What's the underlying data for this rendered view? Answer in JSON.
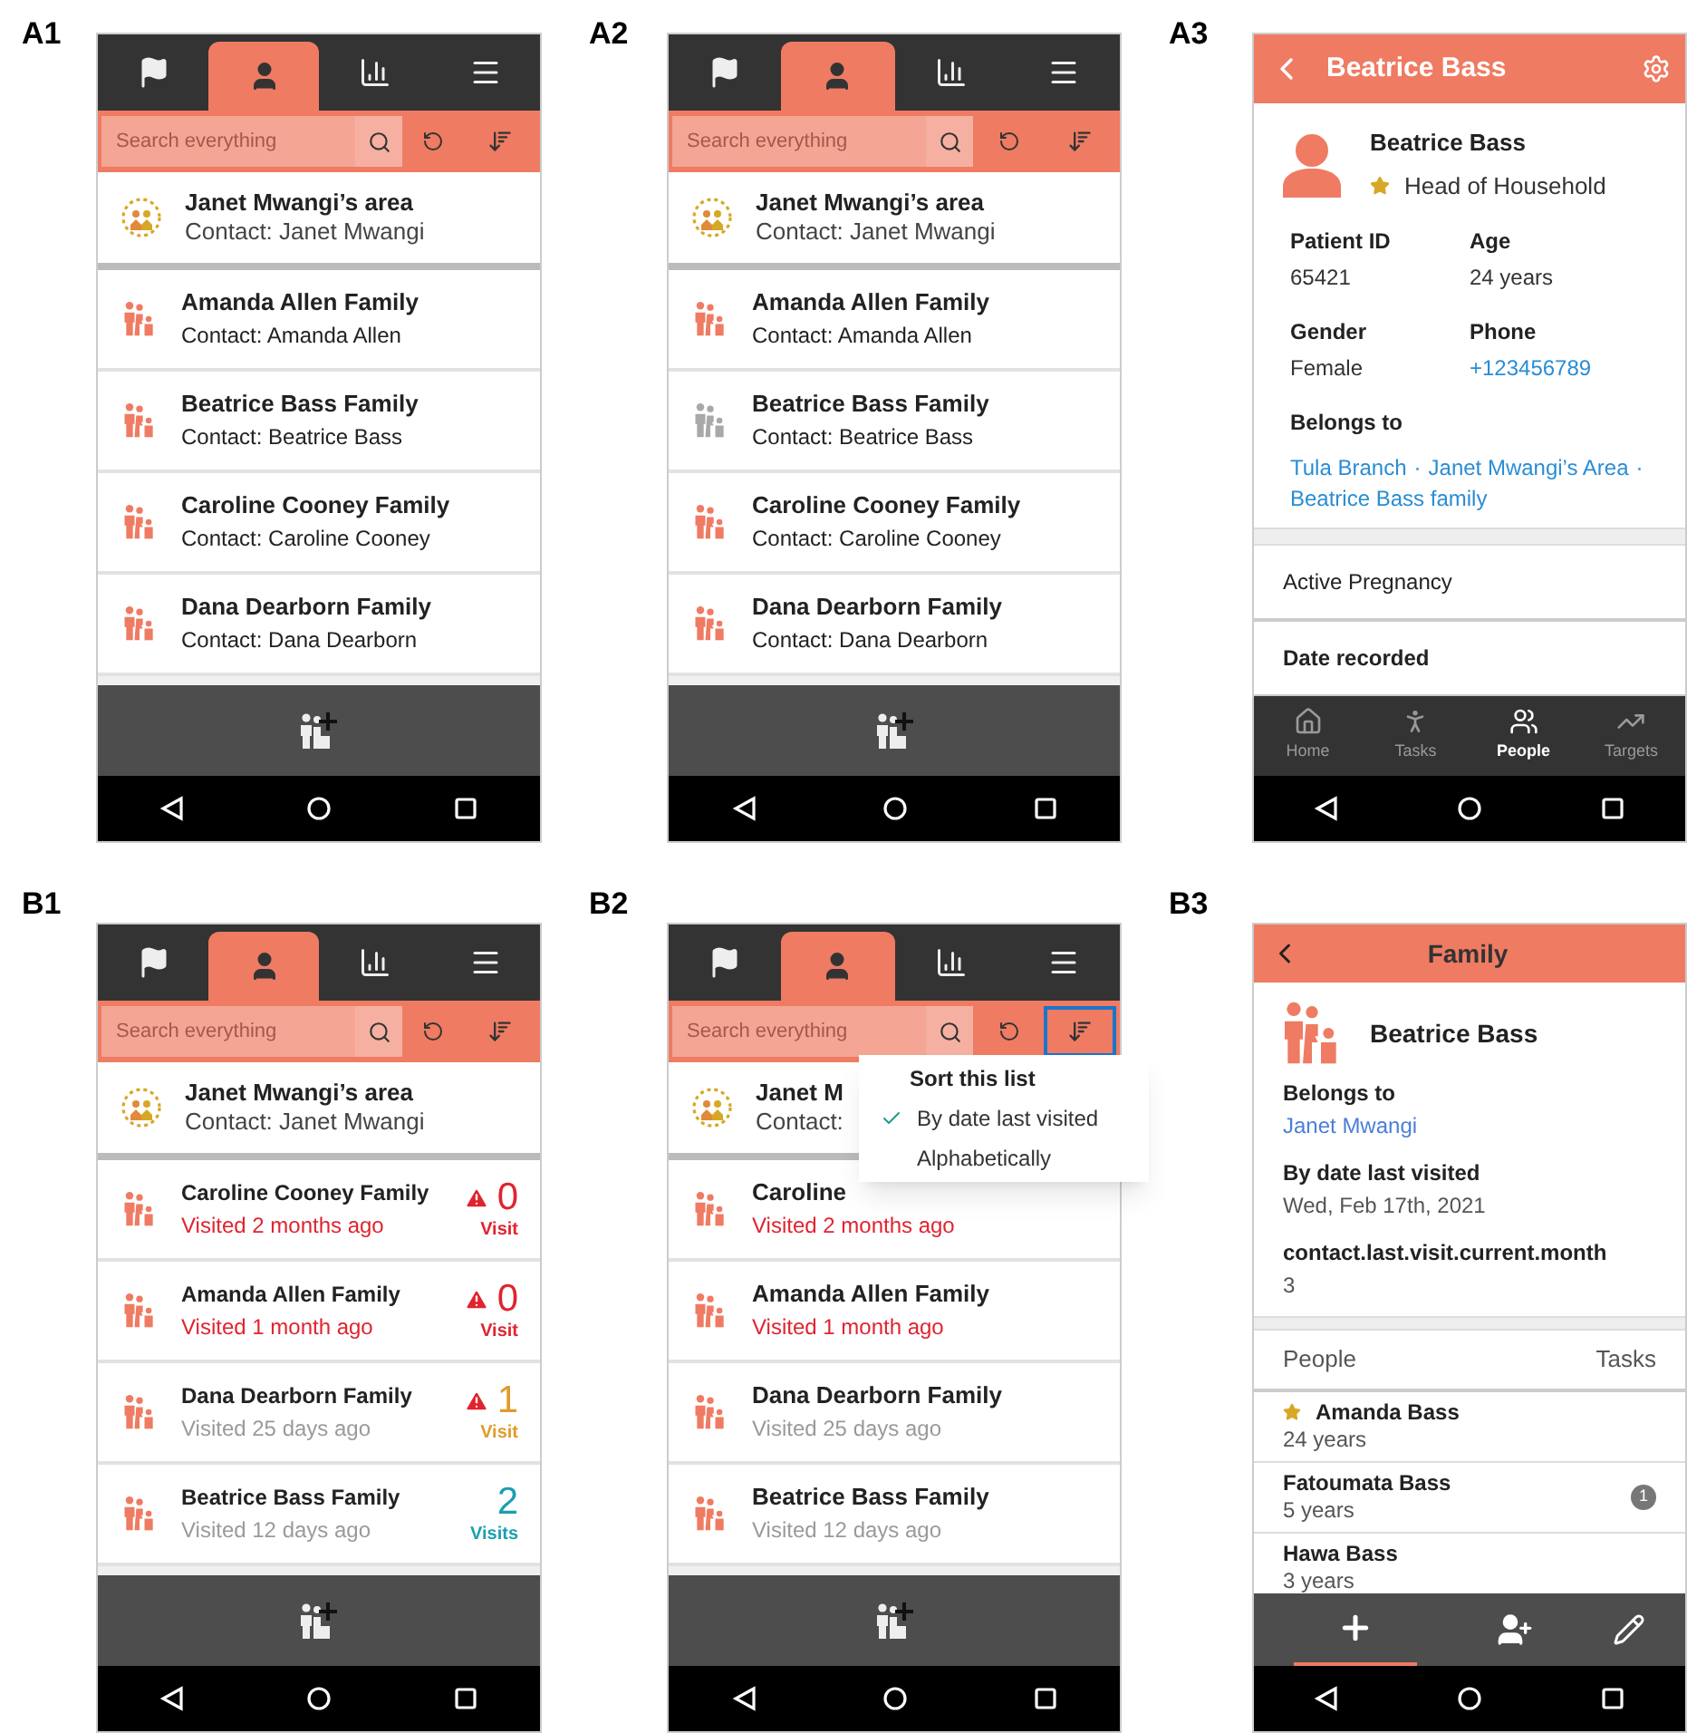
{
  "panels": [
    {
      "label": "A1",
      "kind": "list",
      "tabs": [
        {
          "selected": false
        },
        {
          "selected": true
        },
        {
          "selected": false
        },
        {
          "selected": false
        }
      ],
      "search": {
        "placeholder": "Search everything"
      },
      "sort_highlighted": false,
      "area": {
        "title": "Janet Mwangi’s area",
        "subtitle": "Contact: Janet Mwangi"
      },
      "rows": [
        {
          "title": "Amanda Allen Family",
          "subtitle": "Contact: Amanda Allen",
          "icon_greyed": false
        },
        {
          "title": "Beatrice Bass Family",
          "subtitle": "Contact: Beatrice Bass",
          "icon_greyed": false
        },
        {
          "title": "Caroline Cooney Family",
          "subtitle": "Contact: Caroline Cooney",
          "icon_greyed": false
        },
        {
          "title": "Dana Dearborn Family",
          "subtitle": "Contact: Dana Dearborn",
          "icon_greyed": false
        }
      ]
    },
    {
      "label": "A2",
      "kind": "list",
      "tabs": [
        {
          "selected": false
        },
        {
          "selected": true
        },
        {
          "selected": false
        },
        {
          "selected": false
        }
      ],
      "search": {
        "placeholder": "Search everything"
      },
      "sort_highlighted": false,
      "area": {
        "title": "Janet Mwangi’s area",
        "subtitle": "Contact: Janet Mwangi"
      },
      "rows": [
        {
          "title": "Amanda Allen Family",
          "subtitle": "Contact: Amanda Allen",
          "icon_greyed": false
        },
        {
          "title": "Beatrice Bass Family",
          "subtitle": "Contact: Beatrice Bass",
          "icon_greyed": true
        },
        {
          "title": "Caroline Cooney Family",
          "subtitle": "Contact: Caroline Cooney",
          "icon_greyed": false
        },
        {
          "title": "Dana Dearborn Family",
          "subtitle": "Contact: Dana Dearborn",
          "icon_greyed": false
        }
      ]
    },
    {
      "label": "A3",
      "kind": "detail",
      "header": {
        "title": "Beatrice Bass"
      },
      "profile": {
        "name": "Beatrice Bass",
        "role": "Head of Household"
      },
      "fields": [
        {
          "label": "Patient ID",
          "value": "65421",
          "link": false
        },
        {
          "label": "Age",
          "value": "24 years",
          "link": false
        },
        {
          "label": "Gender",
          "value": "Female",
          "link": false
        },
        {
          "label": "Phone",
          "value": "+123456789",
          "link": true
        }
      ],
      "belongs_to": {
        "label": "Belongs to",
        "separator": "·",
        "links": [
          "Tula Branch",
          "Janet Mwangi’s Area",
          "Beatrice Bass family"
        ]
      },
      "sections": [
        "Active Pregnancy",
        "Date recorded"
      ],
      "bottom_nav": [
        {
          "label": "Home",
          "selected": false
        },
        {
          "label": "Tasks",
          "selected": false
        },
        {
          "label": "People",
          "selected": true
        },
        {
          "label": "Targets",
          "selected": false
        }
      ]
    },
    {
      "label": "B1",
      "kind": "list",
      "tabs": [
        {
          "selected": false
        },
        {
          "selected": true
        },
        {
          "selected": false
        },
        {
          "selected": false
        }
      ],
      "search": {
        "placeholder": "Search everything"
      },
      "sort_highlighted": false,
      "area": {
        "title": "Janet Mwangi’s area",
        "subtitle": "Contact: Janet Mwangi"
      },
      "rows": [
        {
          "title": "Caroline Cooney Family",
          "subtitle": "Visited 2 months ago",
          "icon_greyed": false,
          "overdue": true,
          "count": {
            "value": "0",
            "label": "Visit",
            "warning": true,
            "color": "#e0242f"
          }
        },
        {
          "title": "Amanda Allen Family",
          "subtitle": "Visited 1 month ago",
          "icon_greyed": false,
          "overdue": true,
          "count": {
            "value": "0",
            "label": "Visit",
            "warning": true,
            "color": "#e0242f"
          }
        },
        {
          "title": "Dana Dearborn Family",
          "subtitle": "Visited 25 days ago",
          "icon_greyed": false,
          "overdue": false,
          "count": {
            "value": "1",
            "label": "Visit",
            "warning": true,
            "color": "#e09b2d"
          }
        },
        {
          "title": "Beatrice Bass Family",
          "subtitle": "Visited 12 days ago",
          "icon_greyed": false,
          "overdue": false,
          "count": {
            "value": "2",
            "label": "Visits",
            "warning": false,
            "color": "#1a9fb0"
          }
        }
      ]
    },
    {
      "label": "B2",
      "kind": "list",
      "tabs": [
        {
          "selected": false
        },
        {
          "selected": true
        },
        {
          "selected": false
        },
        {
          "selected": false
        }
      ],
      "search": {
        "placeholder": "Search everything"
      },
      "sort_highlighted": true,
      "area": {
        "title": "Janet M",
        "subtitle": "Contact:"
      },
      "rows": [
        {
          "title": "Caroline",
          "subtitle": "Visited 2 months ago",
          "icon_greyed": false,
          "overdue": true
        },
        {
          "title": "Amanda Allen Family",
          "subtitle": "Visited 1 month ago",
          "icon_greyed": false,
          "overdue": true
        },
        {
          "title": "Dana Dearborn Family",
          "subtitle": "Visited 25 days ago",
          "icon_greyed": false,
          "overdue": false
        },
        {
          "title": "Beatrice Bass Family",
          "subtitle": "Visited 12 days ago",
          "icon_greyed": false,
          "overdue": false
        }
      ],
      "menu": {
        "title": "Sort this list",
        "options": [
          {
            "label": "By date last visited",
            "selected": true
          },
          {
            "label": "Alphabetically",
            "selected": false
          }
        ]
      }
    },
    {
      "label": "B3",
      "kind": "family",
      "header": {
        "title": "Family"
      },
      "name": "Beatrice Bass",
      "fields": [
        {
          "label": "Belongs to",
          "value": "Janet Mwangi",
          "link": true
        },
        {
          "label": "By date last visited",
          "value": "Wed, Feb 17th, 2021",
          "link": false
        },
        {
          "label": "contact.last.visit.current.month",
          "value": "3",
          "link": false
        }
      ],
      "tabs": [
        {
          "label": "People"
        },
        {
          "label": "Tasks"
        }
      ],
      "people": [
        {
          "name": "Amanda Bass",
          "age": "24 years",
          "head_of_household": true
        },
        {
          "name": "Fatoumata Bass",
          "age": "5 years",
          "head_of_household": false,
          "badge": "1"
        },
        {
          "name": "Hawa Bass",
          "age": "3 years",
          "head_of_household": false
        }
      ]
    }
  ]
}
